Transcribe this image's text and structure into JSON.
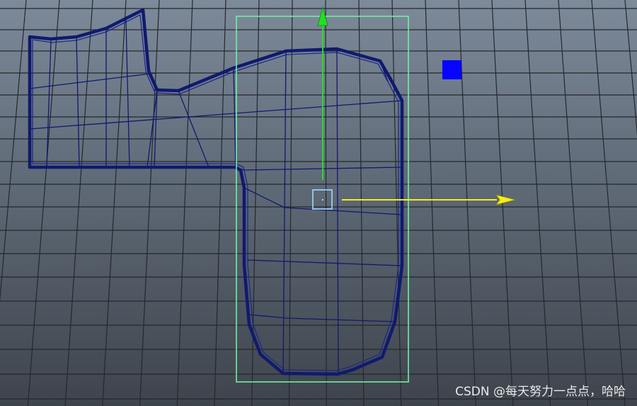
{
  "viewport": {
    "name": "3d-viewport",
    "colors": {
      "grid": "#25282c",
      "mesh": "#101a6e",
      "selection_box": "#6ef0a0",
      "move_y": "#22e022",
      "move_x": "#f2ee18",
      "center_handle": "#9fd8ff",
      "vertex_indicator": "#0505ff"
    },
    "icons": [
      "move-manipulator-y-arrow-icon",
      "move-manipulator-x-arrow-icon",
      "vertex-color-swatch-icon"
    ]
  },
  "watermark": {
    "text": "CSDN @每天努力一点点，哈哈"
  }
}
